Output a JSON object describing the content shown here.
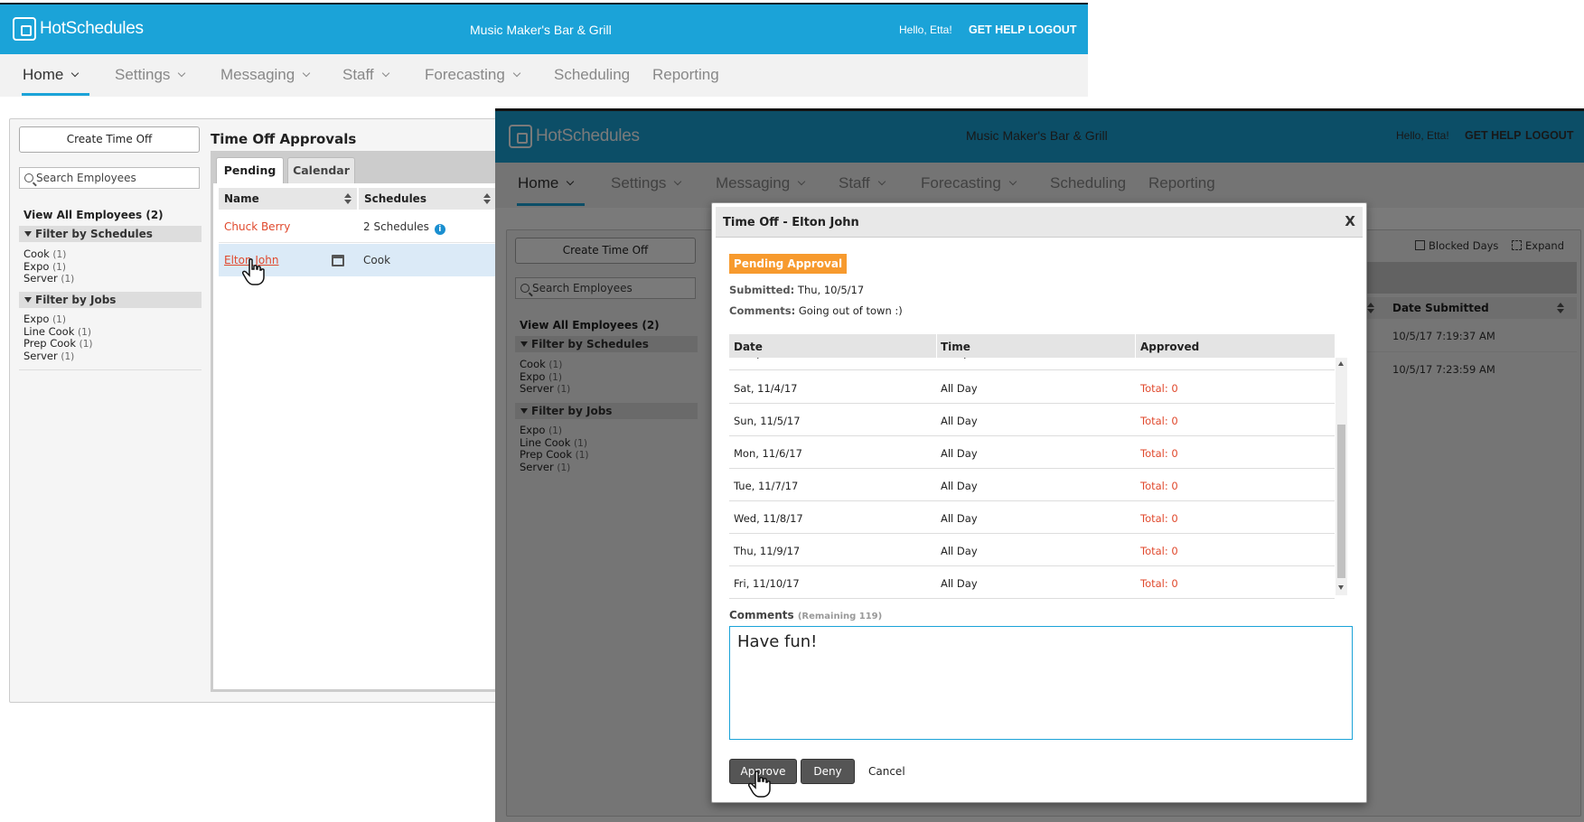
{
  "brand": {
    "logo_text": "HotSchedules",
    "restaurant": "Music Maker's Bar & Grill",
    "hello": "Hello, Etta!",
    "get_help": "GET HELP",
    "logout": "LOGOUT"
  },
  "nav": [
    "Home",
    "Settings",
    "Messaging",
    "Staff",
    "Forecasting",
    "Scheduling",
    "Reporting"
  ],
  "sidebar": {
    "create_btn": "Create Time Off",
    "search_placeholder": "Search Employees",
    "view_all": "View All Employees (2)",
    "filter_schedules_title": "Filter by Schedules",
    "schedules": [
      {
        "name": "Cook",
        "count": "(1)"
      },
      {
        "name": "Expo",
        "count": "(1)"
      },
      {
        "name": "Server",
        "count": "(1)"
      }
    ],
    "filter_jobs_title": "Filter by Jobs",
    "jobs": [
      {
        "name": "Expo",
        "count": "(1)"
      },
      {
        "name": "Line Cook",
        "count": "(1)"
      },
      {
        "name": "Prep Cook",
        "count": "(1)"
      },
      {
        "name": "Server",
        "count": "(1)"
      }
    ]
  },
  "approvals": {
    "title": "Time Off Approvals",
    "tab_pending": "Pending",
    "tab_calendar": "Calendar",
    "col_name": "Name",
    "col_schedules": "Schedules",
    "rows": [
      {
        "name": "Chuck Berry",
        "schedules": "2 Schedules"
      },
      {
        "name": "Elton John",
        "schedules": "Cook"
      }
    ]
  },
  "front_right": {
    "blocked_days": "Blocked Days",
    "expand": "Expand",
    "col_date_submitted": "Date Submitted",
    "dates": [
      "10/5/17 7:19:37 AM",
      "10/5/17 7:23:59 AM"
    ]
  },
  "modal": {
    "title": "Time Off - Elton John",
    "close": "X",
    "badge": "Pending Approval",
    "submitted_label": "Submitted:",
    "submitted_value": "Thu, 10/5/17",
    "comments_label": "Comments:",
    "comments_value": "Going out of town :)",
    "col_date": "Date",
    "col_time": "Time",
    "col_approved": "Approved",
    "rows": [
      {
        "date": "Sat, 11/4/17",
        "time": "All Day",
        "approved": "Total: 0"
      },
      {
        "date": "Sun, 11/5/17",
        "time": "All Day",
        "approved": "Total: 0"
      },
      {
        "date": "Mon, 11/6/17",
        "time": "All Day",
        "approved": "Total: 0"
      },
      {
        "date": "Tue, 11/7/17",
        "time": "All Day",
        "approved": "Total: 0"
      },
      {
        "date": "Wed, 11/8/17",
        "time": "All Day",
        "approved": "Total: 0"
      },
      {
        "date": "Thu, 11/9/17",
        "time": "All Day",
        "approved": "Total: 0"
      },
      {
        "date": "Fri, 11/10/17",
        "time": "All Day",
        "approved": "Total: 0"
      }
    ],
    "comments_title": "Comments",
    "remaining": "(Remaining 119)",
    "comment_text": "Have fun!",
    "approve": "Approve",
    "deny": "Deny",
    "cancel": "Cancel"
  },
  "colors": {
    "brand_blue": "#1ba3d8",
    "badge_orange": "#f79a2e",
    "link_red": "#e0492d"
  }
}
